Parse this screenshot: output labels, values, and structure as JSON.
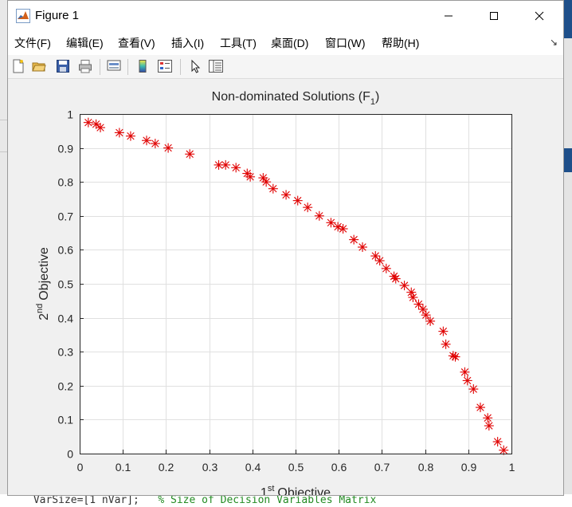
{
  "window": {
    "title": "Figure 1",
    "minimize_label": "minimize",
    "maximize_label": "maximize",
    "close_label": "close"
  },
  "menu": [
    "文件(F)",
    "编辑(E)",
    "查看(V)",
    "插入(I)",
    "工具(T)",
    "桌面(D)",
    "窗口(W)",
    "帮助(H)"
  ],
  "toolbar": [
    {
      "name": "new-figure-icon"
    },
    {
      "name": "open-file-icon"
    },
    {
      "name": "save-icon"
    },
    {
      "name": "print-icon"
    },
    {
      "name": "link-plot-icon"
    },
    {
      "name": "insert-colorbar-icon"
    },
    {
      "name": "insert-legend-icon"
    },
    {
      "name": "edit-plot-arrow-icon"
    },
    {
      "name": "property-inspector-icon"
    }
  ],
  "background_code": {
    "text": " VarSize=[1 nVar];",
    "comment": "   % Size of Decision Variables Matrix"
  },
  "colors": {
    "marker": "#e00000",
    "grid": "#e0e0e0",
    "axes_bg": "#ffffff",
    "figure_bg": "#f0f0f0"
  },
  "chart_data": {
    "type": "scatter",
    "title": "Non-dominated Solutions (F",
    "title_sub": "1",
    "title_end": ")",
    "xlabel": "Objective",
    "xlabel_sup": "st",
    "xlabel_pre": "1",
    "ylabel": "Objective",
    "ylabel_sup": "nd",
    "ylabel_pre": "2",
    "xlim": [
      0,
      1
    ],
    "ylim": [
      0,
      1
    ],
    "xticks": [
      "0",
      "0.1",
      "0.2",
      "0.3",
      "0.4",
      "0.5",
      "0.6",
      "0.7",
      "0.8",
      "0.9",
      "1"
    ],
    "yticks": [
      "0",
      "0.1",
      "0.2",
      "0.3",
      "0.4",
      "0.5",
      "0.6",
      "0.7",
      "0.8",
      "0.9",
      "1"
    ],
    "grid": true,
    "marker": "*",
    "points": [
      [
        0.02,
        0.975
      ],
      [
        0.038,
        0.97
      ],
      [
        0.048,
        0.96
      ],
      [
        0.092,
        0.945
      ],
      [
        0.118,
        0.935
      ],
      [
        0.155,
        0.922
      ],
      [
        0.175,
        0.913
      ],
      [
        0.205,
        0.9
      ],
      [
        0.255,
        0.882
      ],
      [
        0.322,
        0.85
      ],
      [
        0.338,
        0.85
      ],
      [
        0.362,
        0.842
      ],
      [
        0.388,
        0.825
      ],
      [
        0.395,
        0.815
      ],
      [
        0.425,
        0.812
      ],
      [
        0.432,
        0.8
      ],
      [
        0.448,
        0.78
      ],
      [
        0.478,
        0.762
      ],
      [
        0.505,
        0.745
      ],
      [
        0.528,
        0.725
      ],
      [
        0.555,
        0.7
      ],
      [
        0.582,
        0.68
      ],
      [
        0.598,
        0.668
      ],
      [
        0.61,
        0.662
      ],
      [
        0.635,
        0.63
      ],
      [
        0.655,
        0.608
      ],
      [
        0.685,
        0.582
      ],
      [
        0.695,
        0.568
      ],
      [
        0.71,
        0.545
      ],
      [
        0.728,
        0.522
      ],
      [
        0.732,
        0.515
      ],
      [
        0.752,
        0.495
      ],
      [
        0.768,
        0.475
      ],
      [
        0.772,
        0.46
      ],
      [
        0.785,
        0.44
      ],
      [
        0.795,
        0.425
      ],
      [
        0.802,
        0.408
      ],
      [
        0.812,
        0.39
      ],
      [
        0.842,
        0.36
      ],
      [
        0.848,
        0.322
      ],
      [
        0.865,
        0.288
      ],
      [
        0.87,
        0.285
      ],
      [
        0.892,
        0.24
      ],
      [
        0.898,
        0.215
      ],
      [
        0.912,
        0.19
      ],
      [
        0.928,
        0.136
      ],
      [
        0.945,
        0.105
      ],
      [
        0.948,
        0.082
      ],
      [
        0.968,
        0.035
      ],
      [
        0.982,
        0.01
      ]
    ]
  }
}
